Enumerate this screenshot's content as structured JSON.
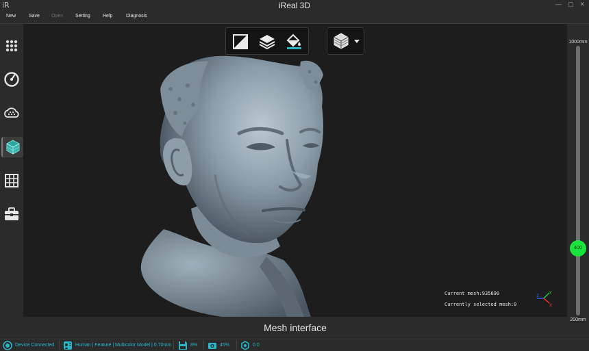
{
  "window": {
    "logo": "iR",
    "title": "iReal 3D",
    "controls": [
      "—",
      "▢",
      "✕"
    ]
  },
  "menu": [
    {
      "label": "New",
      "enabled": true
    },
    {
      "label": "Save",
      "enabled": true
    },
    {
      "label": "Open",
      "enabled": false
    },
    {
      "label": "Setting",
      "enabled": true
    },
    {
      "label": "Help",
      "enabled": true
    },
    {
      "label": "Diagnosis",
      "enabled": true
    }
  ],
  "left_toolbar": [
    {
      "icon": "dot-grid-icon",
      "active": false
    },
    {
      "icon": "scan-dial-icon",
      "active": false
    },
    {
      "icon": "point-cloud-icon",
      "active": false
    },
    {
      "icon": "mesh-cube-icon",
      "active": true
    },
    {
      "icon": "grid-icon",
      "active": false
    },
    {
      "icon": "toolbox-icon",
      "active": false
    }
  ],
  "viewport": {
    "top_tools": [
      "crop-plane-icon",
      "layers-icon",
      "paint-bucket-icon"
    ],
    "view_mode_icon": "mesh-cube-icon",
    "current_mesh_label": "Current mesh:",
    "current_mesh_value": "935690",
    "selected_mesh_label": "Currently selected mesh:",
    "selected_mesh_value": "0",
    "axes": {
      "z": "Z",
      "y": "Y",
      "x": "X"
    },
    "bottom_label": "Mesh interface"
  },
  "depth_slider": {
    "max_label": "1000mm",
    "min_label": "200mm",
    "value": "400",
    "fraction": 0.75
  },
  "status": {
    "device": "Device Connected",
    "mode": "Human | Feature | Multicolor Model | 0.70mm",
    "disk": "8%",
    "camera": "45%",
    "target": "0.0"
  },
  "colors": {
    "accent": "#28b7c9",
    "slider_thumb": "#19e43d",
    "mesh": "#8fa0ab"
  }
}
